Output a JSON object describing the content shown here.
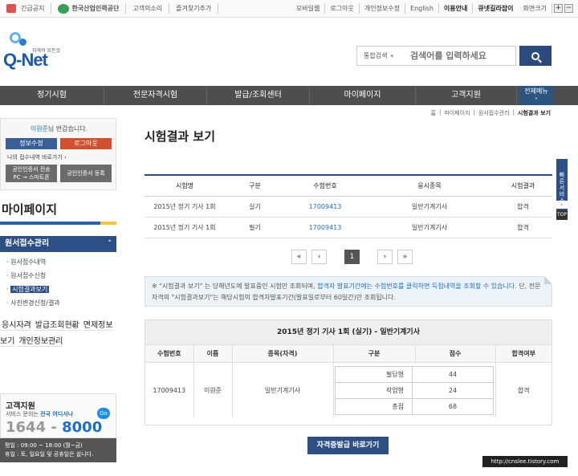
{
  "topbar": {
    "left": [
      "긴급공지",
      "한국산업인력공단",
      "고객의소리",
      "즐겨찾기추가"
    ],
    "right": [
      "모바일웹",
      "로그아웃",
      "개인정보수정",
      "English",
      "이용안내",
      "큐넷길라잡이",
      "화면크기"
    ],
    "zoom_in": "+",
    "zoom_out": "−"
  },
  "logo": {
    "tagline": "자격의 모든것",
    "name": "Q-Net"
  },
  "search": {
    "scope": "통합검색",
    "placeholder": "검색어를 입력하세요"
  },
  "gnb": {
    "items": [
      "정기시험",
      "전문자격시험",
      "발급/조회센터",
      "마이페이지",
      "고객지원"
    ],
    "all_menu": "전체메뉴"
  },
  "login": {
    "name": "이원준",
    "greeting_suffix": "님 반갑습니다.",
    "edit_btn": "정보수정",
    "logout_btn": "로그아웃",
    "shortcut": "나의 접수내역 바로가기",
    "cert_pc_label": "공인인증서 전송",
    "cert_pc_sub": "PC → 스마트폰",
    "cert_reg": "공인인증서 등록"
  },
  "lnb": {
    "title": "마이페이지",
    "section": "원서접수관리",
    "sub_items": [
      "원서접수내역",
      "원서접수신청",
      "시험결과보기",
      "사진변경신청/결과"
    ],
    "menus": [
      "응시자격",
      "발급조회현황",
      "면제정보보기",
      "개인정보관리"
    ]
  },
  "customer": {
    "title": "고객지원",
    "desc_pre": "서비스 문의는 ",
    "desc_hl": "전국 어디서나",
    "number_a": "1644",
    "number_sep": " - ",
    "number_b": "8000",
    "go": "Go",
    "hours1": "평일 : 09:00 ~ 18:00 (월~금)",
    "hours2": "휴일 : 토, 일요일 및 공휴일은 쉽니다."
  },
  "breadcrumb": [
    "홈",
    "마이페이지",
    "원서접수관리",
    "시험결과 보기"
  ],
  "page_title": "시험결과 보기",
  "side_tab": {
    "label": "빠른서비스",
    "arrow": "‹",
    "top": "TOP"
  },
  "results": {
    "headers": [
      "시험명",
      "구분",
      "수험번호",
      "응시종목",
      "시험결과"
    ],
    "rows": [
      [
        "2015년 정기 기사 1회",
        "실기",
        "17009413",
        "일반기계기사",
        "합격"
      ],
      [
        "2015년 정기 기사 1회",
        "필기",
        "17009413",
        "일반기계기사",
        "합격"
      ]
    ]
  },
  "pager": {
    "first": "«",
    "prev": "‹",
    "current": "1",
    "next": "›",
    "last": "»"
  },
  "notice": {
    "part1": "※ \"시험결과 보기\" 는 당해년도에 발표중인 시험만 조회되며, ",
    "part2_blue": "합격자 발표기간에는 수험번호를 클릭하면 득점내역을 조회할 수 있습니다.",
    "part3": " 단, 전문자격의 \"시험결과보기\"는 해당시험의 합격자발표기간(발표일로부터 60일간)만 조회됩니다."
  },
  "detail": {
    "title": "2015년 정기 기사 1회 (실기) - 일반기계기사",
    "headers": [
      "수험번호",
      "이름",
      "종목(자격)",
      "구분",
      "점수",
      "합격여부"
    ],
    "exam_no": "17009413",
    "name": "이원준",
    "subject": "일반기계기사",
    "scores": [
      [
        "필답형",
        "44"
      ],
      [
        "작업형",
        "24"
      ],
      [
        "총점",
        "68"
      ]
    ],
    "result": "합격"
  },
  "cert_button": "자격증발급 바로가기",
  "watermark": "http://cnslee.tistory.com"
}
